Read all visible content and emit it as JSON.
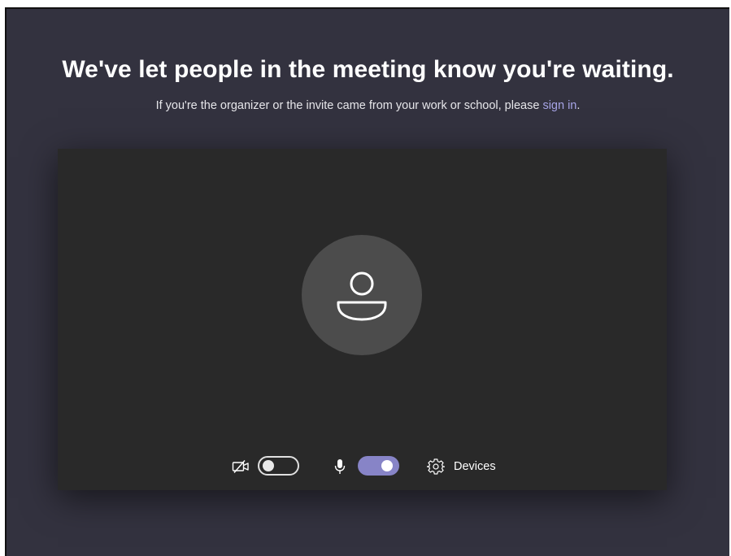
{
  "pre_join": {
    "heading": "We've let people in the meeting know you're waiting.",
    "subtext_prefix": "If you're the organizer or the invite came from your work or school, please ",
    "signin_link": "sign in",
    "subtext_suffix": "."
  },
  "controls": {
    "camera_toggle_state": "off",
    "mic_toggle_state": "on",
    "devices_label": "Devices"
  },
  "colors": {
    "background": "#33323f",
    "preview": "#292929",
    "avatar": "#4c4c4c",
    "accent": "#8784c7",
    "link": "#a6a4e6"
  },
  "icons": {
    "camera": "camera-off-icon",
    "mic": "microphone-icon",
    "devices": "gear-icon",
    "avatar": "person-icon"
  }
}
